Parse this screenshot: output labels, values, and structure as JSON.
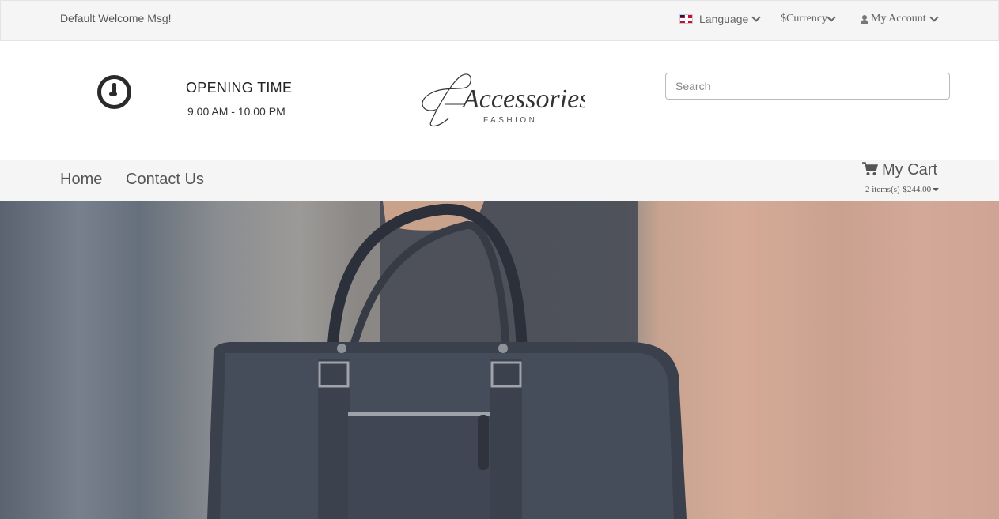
{
  "topbar": {
    "welcome": "Default Welcome Msg!",
    "language_label": "Language",
    "currency_label": "$Currency",
    "account_label": "My Account"
  },
  "header": {
    "opening_title": "OPENING TIME",
    "opening_hours": "9.00 AM - 10.00 PM",
    "logo_text": "Accessories",
    "logo_subtext": "FASHION"
  },
  "search": {
    "placeholder": "Search"
  },
  "nav": {
    "items": [
      {
        "label": "Home"
      },
      {
        "label": "Contact Us"
      }
    ]
  },
  "cart": {
    "title": "My Cart",
    "summary": "2 items(s)-$244.00"
  },
  "colors": {
    "topbar_bg": "#f5f5f5",
    "nav_bg": "#f5f5f5",
    "text_muted": "#555555"
  }
}
